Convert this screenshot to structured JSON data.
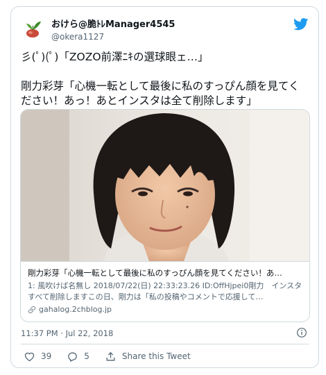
{
  "author": {
    "display_name": "おけら@脆ﾄﾚManager4545",
    "handle": "@okera1127",
    "avatar_icon": "leaf-sprout-avatar"
  },
  "brand": {
    "icon": "twitter-bird-icon",
    "color": "#1d9bf0"
  },
  "tweet": {
    "text": "彡(ﾟ)(ﾟ)「ZOZO前澤ﾆｷの選球眼ェ…」\n\n剛力彩芽「心機一転として最後に私のすっぴん顔を見てください！あっ！あとインスタは全て削除します」"
  },
  "link_card": {
    "image_alt": "short-haired woman portrait photo",
    "title": "剛力彩芽「心機一転として最後に私のすっぴん顔を見てください！あ…",
    "description": "1: 風吹けば名無し 2018/07/22(日) 22:33:23.26 ID:OffHjpei0剛力　インスタすべて削除しますこの日、剛力は「私の投稿やコメントで応援して…",
    "domain": "gahalog.2chblog.jp",
    "domain_icon": "link-icon"
  },
  "timestamp": "11:37 PM · Jul 22, 2018",
  "info_icon": "info-icon",
  "actions": {
    "like_count": "39",
    "reply_count": "5",
    "share_label": "Share this Tweet"
  }
}
